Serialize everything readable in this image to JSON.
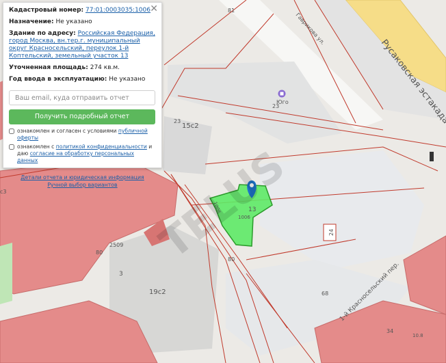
{
  "map": {
    "streets": [
      "Русаковская эстакада",
      "Гаврикова ул.",
      "1-й Красносельский пер."
    ],
    "parcel_labels": [
      "13",
      "1006",
      "1006"
    ],
    "numbers": [
      "81",
      "23",
      "23",
      "15с2",
      "2509",
      "80",
      "80",
      "3",
      "19с2",
      "24",
      "68",
      "34",
      "10.8",
      "с3"
    ],
    "poi_label": "Юго",
    "watermark": "TELUS"
  },
  "panel": {
    "cadastral_label": "Кадастровый номер:",
    "cadastral_value": "77:01:0003035:1006",
    "purpose_label": "Назначение:",
    "purpose_value": "Не указано",
    "building_label": "Здание по адресу:",
    "building_value": "Российская Федерация, город Москва, вн.тер.г. муниципальный округ Красносельский, переулок 1-й Коптельский, земельный участок 13",
    "area_label": "Уточненная площадь:",
    "area_value": "274 кв.м.",
    "year_label": "Год ввода в эксплуатацию:",
    "year_value": "Не указано",
    "email_placeholder": "Ваш email, куда отправить отчет",
    "submit_label": "Получить подробный отчет",
    "offer_text": "ознакомлен и согласен с условиями ",
    "offer_link": "публичной оферты",
    "privacy_text": "ознакомлен с ",
    "privacy_link1": "политикой конфиденциальности",
    "privacy_text2": " и даю ",
    "privacy_link2": "согласие на обработку персональных данных",
    "details_link": "Детали отчета и юридическая информация",
    "manual_link": "Ручной выбор вариантов",
    "close_symbol": "✕"
  },
  "colors": {
    "building": "#e48b8a",
    "parcel_line": "#c0392b",
    "road_yellow": "#f6dd88",
    "selected": "#5eea66",
    "button": "#5cb85c"
  }
}
